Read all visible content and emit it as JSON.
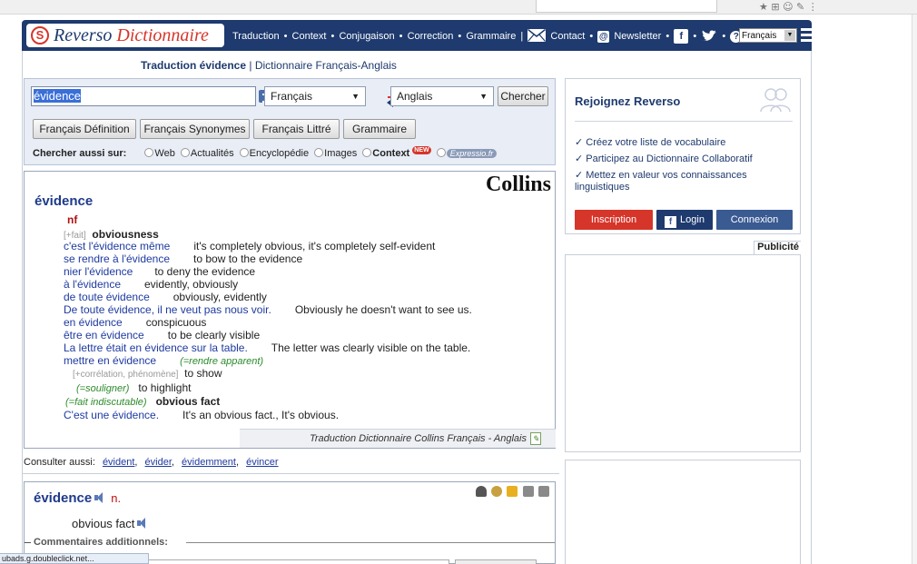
{
  "browser": {
    "toolbar_glyphs": "★  ⊞  ☺  ✎  ⋮"
  },
  "header": {
    "logo": {
      "part1": "Reverso",
      "part2": "Dictionnaire",
      "symbol": "S"
    },
    "nav": {
      "traduction": "Traduction",
      "context": "Context",
      "conjugaison": "Conjugaison",
      "correction": "Correction",
      "grammaire": "Grammaire",
      "contact": "Contact",
      "newsletter": "Newsletter",
      "facebook": "f",
      "twitter": "🐦",
      "help": "?",
      "sep": "•",
      "bar": "|"
    },
    "language": "Français"
  },
  "page_title": {
    "main": "Traduction évidence",
    "sep": " | ",
    "sub": "Dictionnaire Français-Anglais"
  },
  "search": {
    "query": "évidence",
    "source_lang": "Français",
    "target_lang": "Anglais",
    "submit": "Chercher",
    "buttons": [
      "Français Définition",
      "Français Synonymes",
      "Français Littré",
      "Grammaire"
    ],
    "also_label": "Chercher aussi sur:",
    "also_options": [
      "Web",
      "Actualités",
      "Encyclopédie",
      "Images",
      "Context"
    ],
    "new_badge": "NEW",
    "expressio": "Expressio.fr"
  },
  "entry": {
    "brand": "Collins",
    "headword": "évidence",
    "pos": "nf",
    "lines": [
      {
        "gram": "[+fait]",
        "en": "obviousness",
        "bold": true
      },
      {
        "fr": "c'est l'évidence même",
        "en": "it's completely obvious, it's completely self-evident"
      },
      {
        "fr": "se rendre à l'évidence",
        "en": "to bow to the evidence"
      },
      {
        "fr": "nier l'évidence",
        "en": "to deny the evidence"
      },
      {
        "fr": "à l'évidence",
        "en": "evidently, obviously"
      },
      {
        "fr": "de toute évidence",
        "en": "obviously, evidently"
      },
      {
        "fr": "De toute évidence, il ne veut pas nous voir.",
        "en": "Obviously he doesn't want to see us."
      },
      {
        "fr": "en évidence",
        "en": "conspicuous"
      },
      {
        "fr": "être en évidence",
        "en": "to be clearly visible"
      },
      {
        "fr": "La lettre était en évidence sur la table.",
        "en": "The letter was clearly visible on the table."
      },
      {
        "fr": "mettre en évidence",
        "note": "(=rendre apparent)"
      },
      {
        "gram": "[+corrélation, phénomène]",
        "en": "to show"
      },
      {
        "note": "(=souligner)",
        "en": "to highlight"
      },
      {
        "note": "(=fait indiscutable)",
        "en": "obvious fact",
        "bold": true
      },
      {
        "fr": "C'est une évidence.",
        "en": "It's an obvious fact., It's obvious."
      }
    ],
    "footer": "Traduction Dictionnaire Collins Français - Anglais"
  },
  "consult": {
    "label": "Consulter aussi:",
    "links": [
      "évident",
      "évider",
      "évidemment",
      "évincer"
    ],
    "sep": ","
  },
  "collab": {
    "headword": "évidence",
    "pos": "n.",
    "translation": "obvious fact",
    "comments": "Commentaires additionnels:"
  },
  "join": {
    "title": "Rejoignez Reverso",
    "items": [
      "✓ Créez votre liste de vocabulaire",
      "✓ Participez au Dictionnaire Collaboratif",
      "✓ Mettez en valeur vos connaissances linguistiques"
    ],
    "inscription": "Inscription",
    "login": "Login",
    "connexion": "Connexion",
    "fb_glyph": "f"
  },
  "ads": {
    "label": "Publicité"
  },
  "status_bar": "ubads.g.doubleclick.net...",
  "colors": {
    "brand_navy": "#1e3a6e",
    "brand_red": "#d6352a",
    "link_blue": "#1e3aa0",
    "gram_green": "#2a8a2a"
  }
}
